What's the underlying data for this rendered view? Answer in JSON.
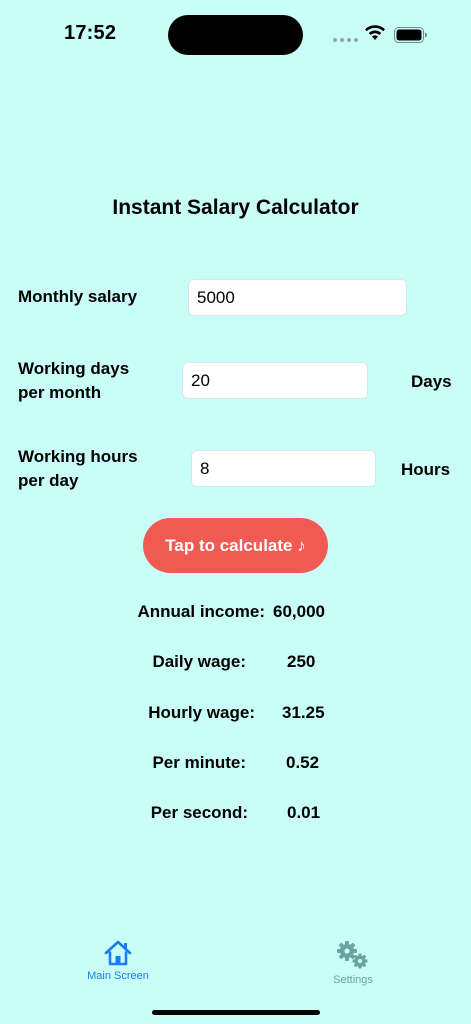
{
  "status_bar": {
    "time": "17:52"
  },
  "title": "Instant Salary Calculator",
  "form": {
    "monthly_salary": {
      "label": "Monthly salary",
      "value": "5000"
    },
    "working_days": {
      "label_line1": "Working days",
      "label_line2": "per month",
      "value": "20",
      "unit": "Days"
    },
    "working_hours": {
      "label_line1": "Working hours",
      "label_line2": "per day",
      "value": "8",
      "unit": "Hours"
    }
  },
  "calculate_button": "Tap to calculate ♪",
  "results": [
    {
      "label": "Annual income:",
      "value": "60,000"
    },
    {
      "label": "Daily wage:",
      "value": "250"
    },
    {
      "label": "Hourly wage:",
      "value": "31.25"
    },
    {
      "label": "Per minute:",
      "value": "0.52"
    },
    {
      "label": "Per second:",
      "value": "0.01"
    }
  ],
  "tab_bar": {
    "main": {
      "label": "Main Screen",
      "icon": "home-icon",
      "active": true,
      "color": "#1a7bf2"
    },
    "settings": {
      "label": "Settings",
      "icon": "gears-icon",
      "active": false,
      "color": "#6aa3a0"
    }
  },
  "colors": {
    "background": "#c8fdf8",
    "button": "#f15a52"
  }
}
